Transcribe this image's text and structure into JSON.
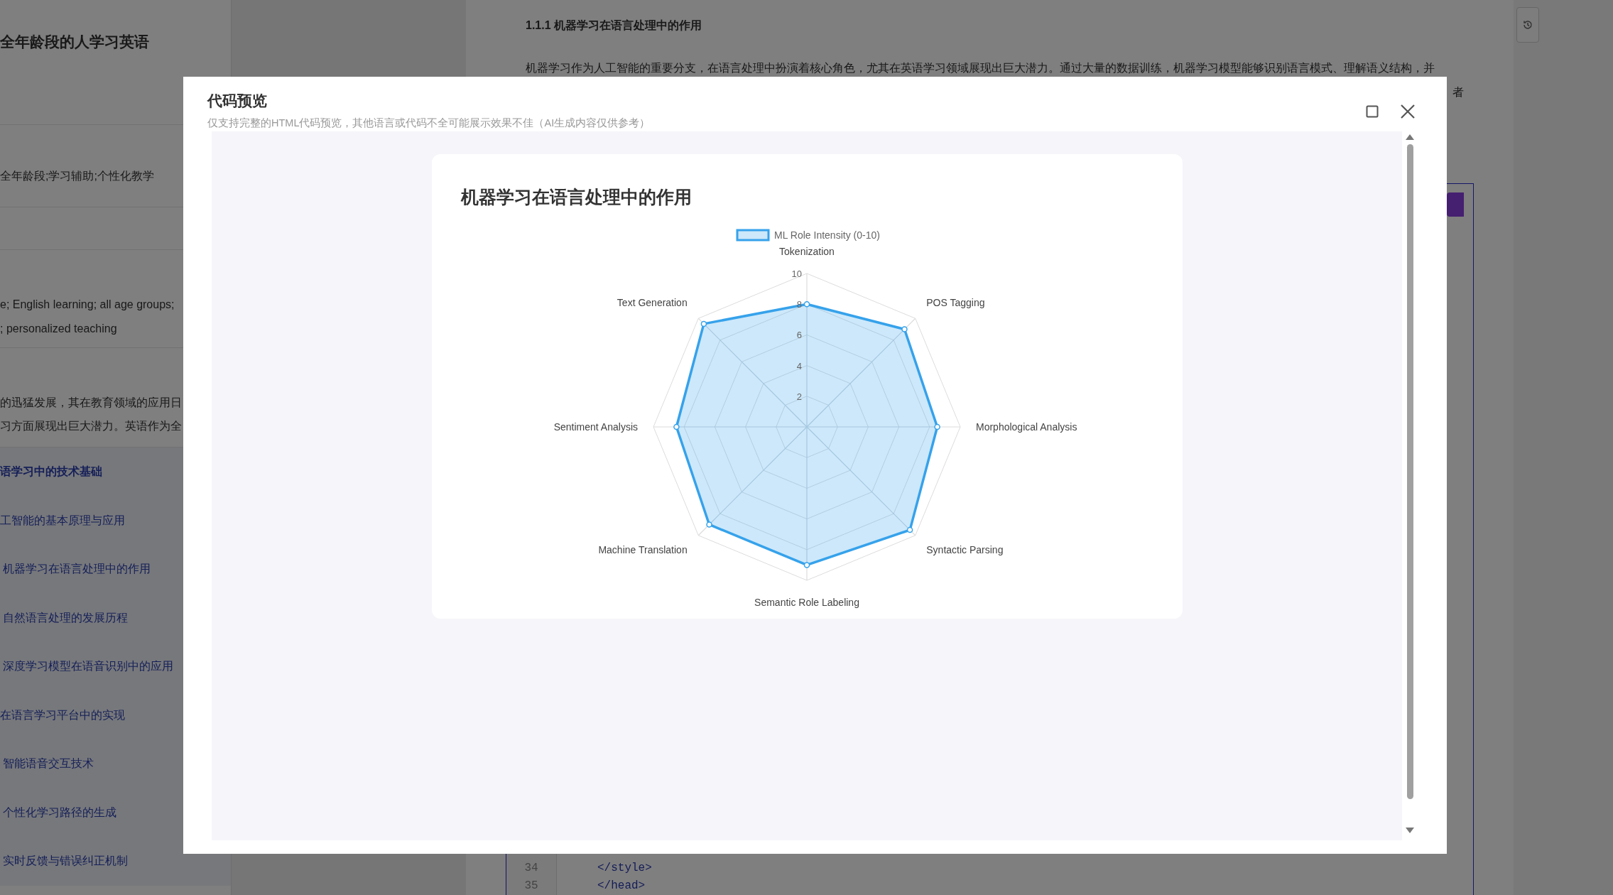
{
  "sidebar": {
    "title": "全年龄段的人学习英语",
    "tags": "全年龄段;学习辅助;个性化教学",
    "keywords": [
      "e; English learning; all age groups;",
      "; personalized teaching"
    ],
    "abstract": [
      "的迅猛发展，其在教育领域的应用日",
      "习方面展现出巨大潜力。英语作为全"
    ],
    "toc": [
      {
        "label": "语学习中的技术基础",
        "kind": "chapter"
      },
      {
        "label": "工智能的基本原理与应用",
        "kind": "section",
        "children": [
          {
            "label": "机器学习在语言处理中的作用",
            "kind": "section"
          },
          {
            "label": "自然语言处理的发展历程",
            "kind": "section"
          },
          {
            "label": "深度学习模型在语音识别中的应用",
            "kind": "section"
          }
        ]
      },
      {
        "label": "在语言学习平台中的实现",
        "kind": "section",
        "children": [
          {
            "label": "智能语音交互技术",
            "kind": "section"
          },
          {
            "label": "个性化学习路径的生成",
            "kind": "section"
          },
          {
            "label": "实时反馈与错误纠正机制",
            "kind": "section"
          }
        ]
      }
    ]
  },
  "document": {
    "heading": "1.1.1 机器学习在语言处理中的作用",
    "paragraph": "机器学习作为人工智能的重要分支，在语言处理中扮演着核心角色，尤其在英语学习领域展现出巨大潜力。通过大量的数据训练，机器学习模型能够识别语言模式、理解语义结构，并",
    "paragraph_tail": "者",
    "code_lines": [
      {
        "number": "34",
        "code": "</style>"
      },
      {
        "number": "35",
        "code": "</head>"
      }
    ]
  },
  "modal": {
    "title": "代码预览",
    "subtitle": "仅支持完整的HTML代码预览，其他语言或代码不全可能展示效果不佳（AI生成内容仅供参考）",
    "card_title": "机器学习在语言处理中的作用",
    "radar": {
      "legend": "ML Role Intensity (0-10)",
      "color": "#36a2eb",
      "ticks": [
        "10",
        "8",
        "6",
        "4",
        "2"
      ],
      "axes": [
        {
          "label": "Tokenization",
          "level": 0.8
        },
        {
          "label": "POS Tagging",
          "level": 0.9
        },
        {
          "label": "Morphological Analysis",
          "level": 0.85
        },
        {
          "label": "Syntactic Parsing",
          "level": 0.95
        },
        {
          "label": "Semantic Role Labeling",
          "level": 0.9
        },
        {
          "label": "Machine Translation",
          "level": 0.9
        },
        {
          "label": "Sentiment Analysis",
          "level": 0.85
        },
        {
          "label": "Text Generation",
          "level": 0.95
        }
      ]
    }
  }
}
